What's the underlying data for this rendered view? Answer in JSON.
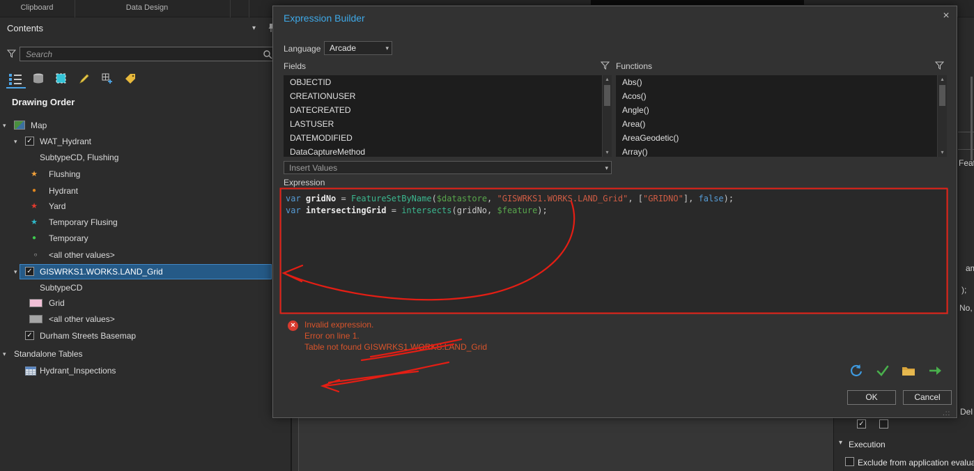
{
  "colors": {
    "accent_blue": "#3fa9e8",
    "selection_blue": "#255a87",
    "error_orange": "#d9542b",
    "annotation_red": "#e41e14",
    "grid_swatch_pink": "#f2c0d7",
    "other_swatch_gray": "#a6a6a6"
  },
  "icons": {
    "expanded": "▾",
    "collapsed": "▸",
    "up": "▴",
    "down": "▾",
    "close": "×",
    "check": "✓",
    "star": "★",
    "dot": "●",
    "ring": "○",
    "error_x": "×",
    "grip": ".::",
    "toolbar_icons": [
      "list-by-drawing-order",
      "list-by-data-source",
      "list-by-selection",
      "list-by-editing",
      "list-by-snapping",
      "list-by-labeling"
    ]
  },
  "ribbon": {
    "tabs": [
      "Clipboard",
      "Data Design"
    ]
  },
  "contents": {
    "title": "Contents",
    "search_placeholder": "Search",
    "section_label": "Drawing Order",
    "tree": {
      "map": "Map",
      "wat_hydrant": "WAT_Hydrant",
      "subtype_flushing": "SubtypeCD, Flushing",
      "flushing": "Flushing",
      "hydrant": "Hydrant",
      "yard": "Yard",
      "temporary_flusing": "Temporary Flusing",
      "temporary": "Temporary",
      "all_other_values_hydrant": "<all other values>",
      "land_grid": "GISWRKS1.WORKS.LAND_Grid",
      "subtypecd": "SubtypeCD",
      "grid": "Grid",
      "all_other_values_grid": "<all other values>",
      "durham": "Durham Streets Basemap",
      "standalone_tables": "Standalone Tables",
      "hydrant_inspections": "Hydrant_Inspections"
    }
  },
  "dialog": {
    "title": "Expression Builder",
    "language_label": "Language",
    "language_value": "Arcade",
    "fields_label": "Fields",
    "functions_label": "Functions",
    "fields": [
      "OBJECTID",
      "CREATIONUSER",
      "DATECREATED",
      "LASTUSER",
      "DATEMODIFIED",
      "DataCaptureMethod"
    ],
    "functions": [
      "Abs()",
      "Acos()",
      "Angle()",
      "Area()",
      "AreaGeodetic()",
      "Array()"
    ],
    "insert_values_label": "Insert Values",
    "expression_label": "Expression",
    "code": {
      "lines": [
        [
          {
            "t": "var",
            "c": "kw"
          },
          {
            "t": " ",
            "c": "pl"
          },
          {
            "t": "gridNo",
            "c": "dcl"
          },
          {
            "t": " = ",
            "c": "pl"
          },
          {
            "t": "FeatureSetByName",
            "c": "fn"
          },
          {
            "t": "(",
            "c": "pl"
          },
          {
            "t": "$datastore",
            "c": "gl"
          },
          {
            "t": ", ",
            "c": "pl"
          },
          {
            "t": "\"GISWRKS1.WORKS.LAND_Grid\"",
            "c": "st"
          },
          {
            "t": ", ",
            "c": "pl"
          },
          {
            "t": "[",
            "c": "pl"
          },
          {
            "t": "\"GRIDNO\"",
            "c": "st"
          },
          {
            "t": "]",
            "c": "pl"
          },
          {
            "t": ", ",
            "c": "pl"
          },
          {
            "t": "false",
            "c": "kw"
          },
          {
            "t": ");",
            "c": "pl"
          }
        ],
        [
          {
            "t": "var",
            "c": "kw"
          },
          {
            "t": " ",
            "c": "pl"
          },
          {
            "t": "intersectingGrid",
            "c": "dcl"
          },
          {
            "t": " = ",
            "c": "pl"
          },
          {
            "t": "intersects",
            "c": "fn"
          },
          {
            "t": "(",
            "c": "pl"
          },
          {
            "t": "gridNo",
            "c": "pl"
          },
          {
            "t": ", ",
            "c": "pl"
          },
          {
            "t": "$feature",
            "c": "gl"
          },
          {
            "t": ");",
            "c": "pl"
          }
        ]
      ]
    },
    "error": {
      "line1": "Invalid expression.",
      "line2": "Error on line 1.",
      "line3": "Table not found GISWRKS1.WORKS.LAND_Grid"
    },
    "buttons": {
      "ok": "OK",
      "cancel": "Cancel"
    }
  },
  "right_panel": {
    "fragments": {
      "f1": "Featu",
      "f2": "ame",
      "f3": ");",
      "f4": "No,",
      "f5": "Del"
    },
    "execution_label": "Execution",
    "exclude_label": "Exclude from application evaluat"
  }
}
